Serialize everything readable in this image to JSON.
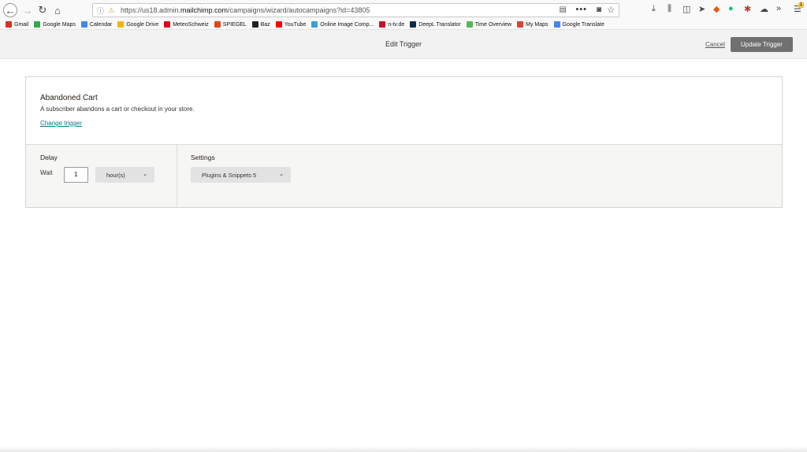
{
  "browser": {
    "url_prefix": "https://us18.admin.",
    "url_domain": "mailchimp.com",
    "url_path": "/campaigns/wizard/autocampaigns?id=43805",
    "url_more": "•••",
    "menu_badge": "1"
  },
  "bookmarks": [
    {
      "label": "Gmail",
      "color": "#d93025"
    },
    {
      "label": "Google Maps",
      "color": "#34a853"
    },
    {
      "label": "Calendar",
      "color": "#4285f4"
    },
    {
      "label": "Google Drive",
      "color": "#f4b400"
    },
    {
      "label": "MeteoSchweiz",
      "color": "#e2001a"
    },
    {
      "label": "SPIEGEL",
      "color": "#e64415"
    },
    {
      "label": "Baz",
      "color": "#222222"
    },
    {
      "label": "YouTube",
      "color": "#ff0000"
    },
    {
      "label": "Online Image Comp...",
      "color": "#3aa0d8"
    },
    {
      "label": "n-tv.de",
      "color": "#c8102e"
    },
    {
      "label": "DeepL Translator",
      "color": "#0f2b46"
    },
    {
      "label": "Time Overview",
      "color": "#5ab55a"
    },
    {
      "label": "My Maps",
      "color": "#db4437"
    },
    {
      "label": "Google Translate",
      "color": "#4285f4"
    }
  ],
  "header": {
    "title": "Edit Trigger",
    "cancel_label": "Cancel",
    "update_label": "Update Trigger"
  },
  "trigger": {
    "title": "Abandoned Cart",
    "description": "A subscriber abandons a cart or checkout in your store.",
    "change_label": "Change trigger"
  },
  "delay": {
    "title": "Delay",
    "wait_label": "Wait",
    "value": "1",
    "unit": "hour(s)"
  },
  "settings": {
    "title": "Settings",
    "selected": "Plugins & Snippets 5"
  }
}
